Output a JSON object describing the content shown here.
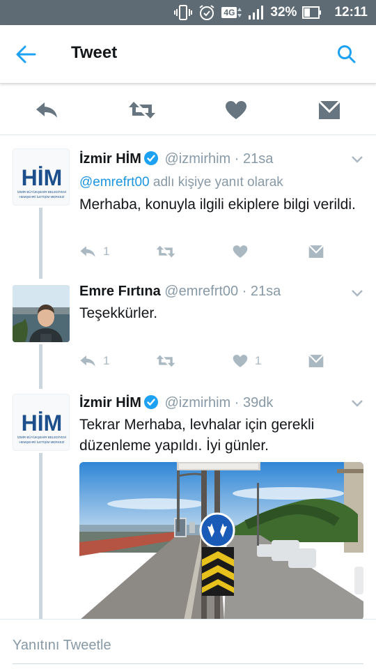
{
  "status_bar": {
    "network": "4G",
    "battery": "32%",
    "time": "12:11",
    "icons": [
      "vibrate-icon",
      "alarm-icon",
      "network-4g-icon",
      "signal-icon",
      "battery-icon"
    ]
  },
  "header": {
    "title": "Tweet",
    "back_icon": "back-arrow-icon",
    "search_icon": "search-icon"
  },
  "colors": {
    "accent": "#1da1f2",
    "status_bar": "#5e6b74",
    "secondary_text": "#8899a6",
    "action_icons": "#aab8c2",
    "header_action_icons": "#66757f"
  },
  "top_actions": [
    {
      "name": "reply",
      "icon": "reply-icon"
    },
    {
      "name": "retweet",
      "icon": "retweet-icon"
    },
    {
      "name": "like",
      "icon": "heart-icon"
    },
    {
      "name": "message",
      "icon": "envelope-icon"
    }
  ],
  "tweets": [
    {
      "name": "İzmir HİM",
      "verified": true,
      "handle": "@izmirhim",
      "time": "· 21sa",
      "reply_to_mention": "@emrefrt00",
      "reply_to_suffix": "adlı kişiye yanıt olarak",
      "text": "Merhaba, konuyla ilgili ekiplere bilgi verildi.",
      "reply_count": "1",
      "like_count": "",
      "avatar": {
        "logo_text": "HİM",
        "line1": "İZMİR BÜYÜKŞEHİR BELEDİYESİ",
        "line2": "HEMŞEHRİ İLETİŞİM MERKEZİ"
      }
    },
    {
      "name": "Emre Fırtına",
      "verified": false,
      "handle": "@emrefrt00",
      "time": "· 21sa",
      "text": "Teşekkürler.",
      "reply_count": "1",
      "like_count": "1"
    },
    {
      "name": "İzmir HİM",
      "verified": true,
      "handle": "@izmirhim",
      "time": "· 39dk",
      "text": "Tekrar Merhaba, levhalar için gerekli düzenleme yapıldı. İyi günler.",
      "avatar": {
        "logo_text": "HİM",
        "line1": "İZMİR BÜYÜKŞEHİR BELEDİYESİ",
        "line2": "HEMŞEHRİ İLETİŞİM MERKEZİ"
      }
    }
  ],
  "composer": {
    "placeholder": "Yanıtını Tweetle"
  }
}
